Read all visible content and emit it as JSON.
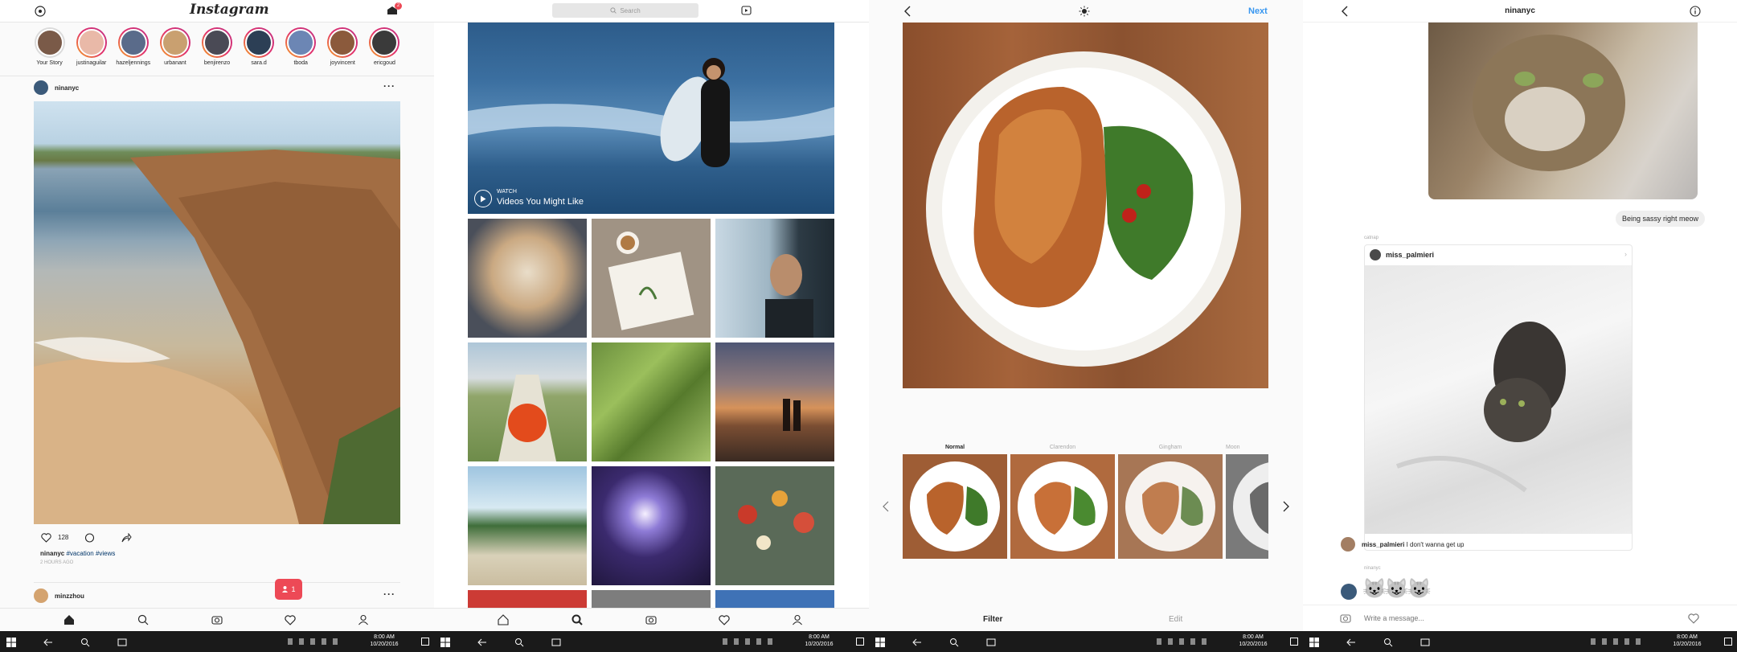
{
  "feed": {
    "logo": "Instagram",
    "notification_count": "2",
    "stories": [
      {
        "name": "Your Story",
        "color": "#7a5a48",
        "ring": false
      },
      {
        "name": "justinaguilar",
        "color": "#e9b9a8",
        "ring": true
      },
      {
        "name": "hazeljennings",
        "color": "#5a6b8a",
        "ring": true
      },
      {
        "name": "urbanant",
        "color": "#c9a070",
        "ring": true
      },
      {
        "name": "benjirenzo",
        "color": "#4a4a55",
        "ring": true
      },
      {
        "name": "sara.d",
        "color": "#2c3f55",
        "ring": true
      },
      {
        "name": "tboda",
        "color": "#6c86b4",
        "ring": true
      },
      {
        "name": "joyvincent",
        "color": "#8b5a3c",
        "ring": true
      },
      {
        "name": "ericgoud",
        "color": "#3a3a3a",
        "ring": true
      }
    ],
    "post": {
      "username": "ninanyc",
      "likes": "128",
      "caption_user": "ninanyc",
      "caption_tags": "#vacation #views",
      "time": "2 HOURS AGO"
    },
    "next_post_username": "minzzhou",
    "activity_badge_count": "1"
  },
  "explore": {
    "search_placeholder": "Search",
    "video_kicker": "WATCH",
    "video_title": "Videos You Might Like"
  },
  "editor": {
    "next_label": "Next",
    "filters": [
      "Normal",
      "Clarendon",
      "Gingham",
      "Moon"
    ],
    "tab_filter": "Filter",
    "tab_edit": "Edit"
  },
  "direct": {
    "title": "ninanyc",
    "sent_message": "Being sassy right meow",
    "share_label": "catnap",
    "shared_user": "miss_palmieri",
    "comment_user": "miss_palmieri",
    "comment_text": "I don't wanna get up",
    "reply_label": "ninanyc",
    "emoji": "😺😺😺",
    "input_placeholder": "Write a message..."
  },
  "taskbar": {
    "times": [
      "8:00 AM",
      "8:00 AM",
      "8:00 AM",
      "8:00 AM"
    ],
    "dates": [
      "10/20/2016",
      "10/20/2016",
      "10/20/2016",
      "10/20/2016"
    ]
  },
  "colors": {
    "accent": "#3897f0",
    "badge": "#ed4956",
    "taskbar": "#1a1a1a"
  }
}
